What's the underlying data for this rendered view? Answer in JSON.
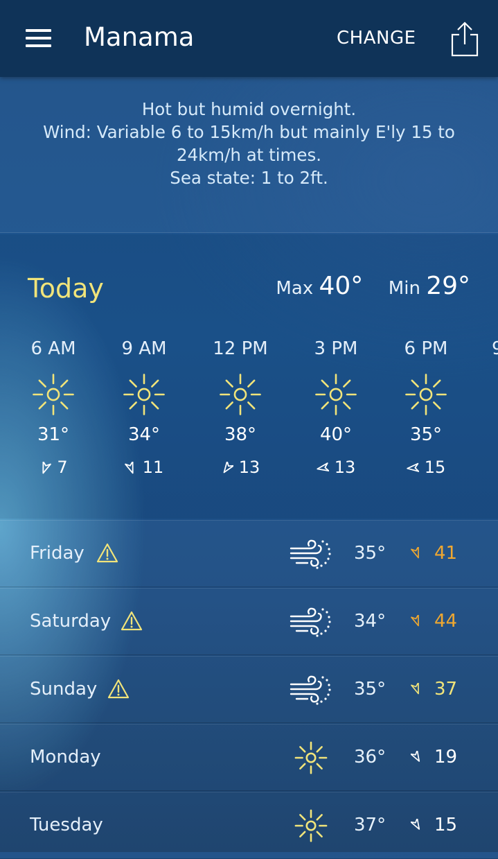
{
  "header": {
    "city": "Manama",
    "change_label": "CHANGE",
    "menu_icon": "hamburger-menu-icon",
    "share_icon": "share-icon"
  },
  "synopsis": {
    "lines": [
      "Hot but humid overnight.",
      "Wind: Variable 6 to 15km/h but mainly E'ly 15 to",
      "24km/h at times.",
      "Sea state: 1 to 2ft."
    ]
  },
  "today": {
    "label": "Today",
    "max_label": "Max",
    "max_value": "40°",
    "min_label": "Min",
    "min_value": "29°",
    "hours": [
      {
        "time": "6 AM",
        "icon": "sun-icon",
        "temp": "31°",
        "wind": "7",
        "wind_dir_deg": 200
      },
      {
        "time": "9 AM",
        "icon": "sun-icon",
        "temp": "34°",
        "wind": "11",
        "wind_dir_deg": 160
      },
      {
        "time": "12 PM",
        "icon": "sun-icon",
        "temp": "38°",
        "wind": "13",
        "wind_dir_deg": 215
      },
      {
        "time": "3 PM",
        "icon": "sun-icon",
        "temp": "40°",
        "wind": "13",
        "wind_dir_deg": 260
      },
      {
        "time": "6 PM",
        "icon": "sun-icon",
        "temp": "35°",
        "wind": "15",
        "wind_dir_deg": 265
      },
      {
        "time": "9",
        "icon": "sun-icon",
        "temp": "",
        "wind": "",
        "wind_dir_deg": 0
      }
    ]
  },
  "days": [
    {
      "day": "Friday",
      "warning": true,
      "icon": "windy-dust-icon",
      "temp": "35°",
      "wind": "41",
      "wind_color": "#f0a830",
      "arrow_color": "#f0a830"
    },
    {
      "day": "Saturday",
      "warning": true,
      "icon": "windy-dust-icon",
      "temp": "34°",
      "wind": "44",
      "wind_color": "#f0a830",
      "arrow_color": "#f0a830"
    },
    {
      "day": "Sunday",
      "warning": true,
      "icon": "windy-dust-icon",
      "temp": "35°",
      "wind": "37",
      "wind_color": "#f1e47a",
      "arrow_color": "#f1e47a"
    },
    {
      "day": "Monday",
      "warning": false,
      "icon": "sun-icon",
      "temp": "36°",
      "wind": "19",
      "wind_color": "#ffffff",
      "arrow_color": "#ffffff"
    },
    {
      "day": "Tuesday",
      "warning": false,
      "icon": "sun-icon",
      "temp": "37°",
      "wind": "15",
      "wind_color": "#ffffff",
      "arrow_color": "#ffffff"
    }
  ],
  "colors": {
    "accent_yellow": "#f1e47a",
    "warning_orange": "#f0a830",
    "header_bg": "#0f3358"
  }
}
